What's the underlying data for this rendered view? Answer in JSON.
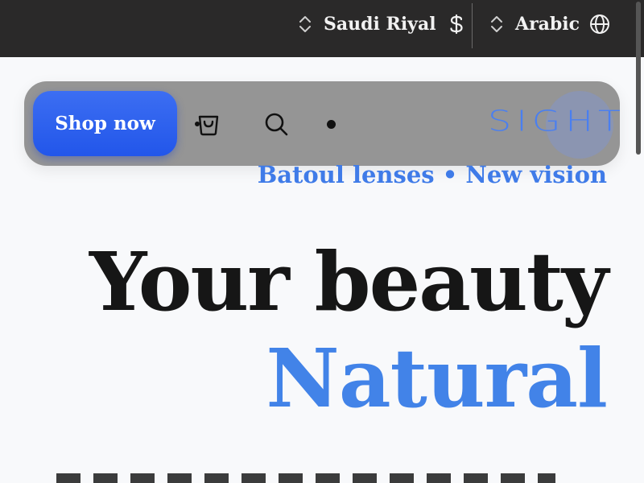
{
  "topbar": {
    "currency": {
      "label": "Saudi Riyal",
      "icon": "dollar-sign-icon"
    },
    "language": {
      "label": "Arabic",
      "icon": "globe-icon"
    },
    "updown_icon": "chevron-up-down-icon"
  },
  "nav": {
    "shop_label": "Shop now",
    "cart_icon": "shopping-bag-icon",
    "search_icon": "search-icon",
    "logo": "SIGHT"
  },
  "hero": {
    "tagline": "Batoul lenses • New vision",
    "headline_line1": "Your beauty",
    "headline_line2": "Natural"
  },
  "colors": {
    "topbar_bg": "#2a2929",
    "accent_blue": "#2256ea",
    "headline_blue": "#4283e8",
    "nav_bg": "#959595"
  }
}
